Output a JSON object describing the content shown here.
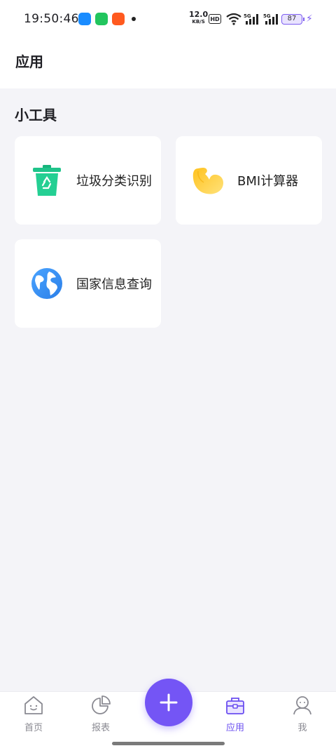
{
  "status_bar": {
    "time": "19:50:46",
    "net_speed": "12.0",
    "net_unit": "KB/S",
    "hd": "HD",
    "sig1": "5G",
    "sig2": "5G",
    "battery": "87"
  },
  "header": {
    "title": "应用"
  },
  "section": {
    "title": "小工具"
  },
  "tools": [
    {
      "label": "垃圾分类识别",
      "icon": "trash-recycle-icon"
    },
    {
      "label": "BMI计算器",
      "icon": "muscle-arm-icon"
    },
    {
      "label": "国家信息查询",
      "icon": "globe-icon"
    }
  ],
  "tab_bar": {
    "items": [
      {
        "label": "首页",
        "icon": "home-icon"
      },
      {
        "label": "报表",
        "icon": "pie-chart-icon"
      },
      {
        "label": "应用",
        "icon": "toolbox-icon",
        "active": true
      },
      {
        "label": "我",
        "icon": "user-icon"
      }
    ],
    "fab_icon": "plus-icon"
  },
  "colors": {
    "accent": "#7455f5",
    "background": "#f4f4f8",
    "card": "#ffffff"
  }
}
